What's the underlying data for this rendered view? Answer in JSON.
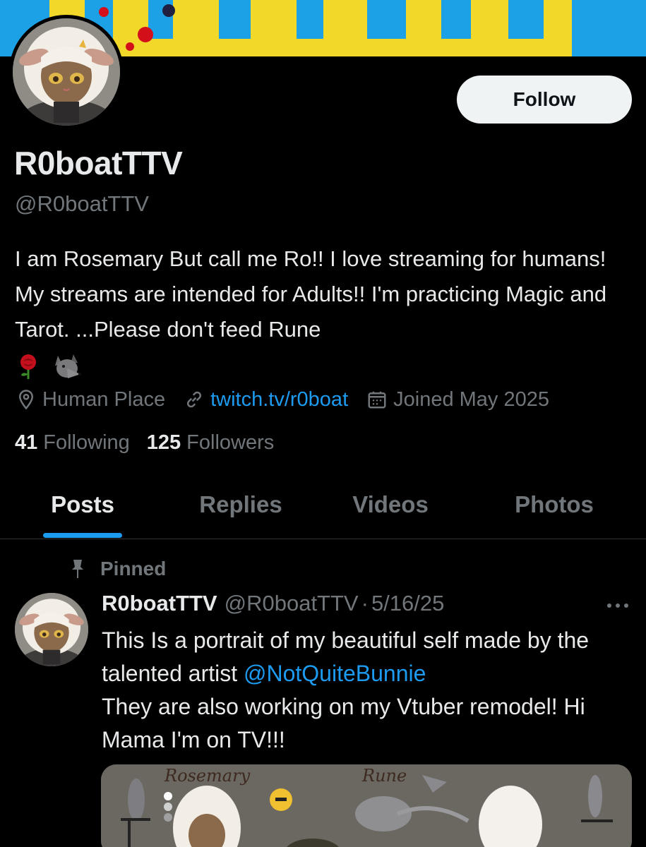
{
  "profile": {
    "display_name": "R0boatTTV",
    "handle": "@R0boatTTV",
    "follow_label": "Follow",
    "bio": "I am Rosemary But call me Ro!! I love streaming for humans! My streams are intended for Adults!! I'm practicing Magic and Tarot. ...Please don't feed Rune",
    "bio_emoji": [
      "rose-emoji",
      "wolf-emoji"
    ],
    "location": "Human Place",
    "website": "twitch.tv/r0boat",
    "joined": "Joined May 2025",
    "following_count": "41",
    "following_label": "Following",
    "followers_count": "125",
    "followers_label": "Followers"
  },
  "tabs": [
    {
      "label": "Posts",
      "active": true
    },
    {
      "label": "Replies",
      "active": false
    },
    {
      "label": "Videos",
      "active": false
    },
    {
      "label": "Photos",
      "active": false
    }
  ],
  "pinned_post": {
    "pinned_label": "Pinned",
    "author_name": "R0boatTTV",
    "author_handle": "@R0boatTTV",
    "separator": "·",
    "date": "5/16/25",
    "text_line1": "This Is a portrait of my beautiful self made by the talented artist ",
    "mention": "@NotQuiteBunnie",
    "text_line2": "They are also working on my Vtuber remodel! Hi Mama I'm on TV!!!",
    "media_labels": [
      "Rosemary",
      "Rune"
    ]
  },
  "colors": {
    "background": "#000000",
    "accent": "#1d9bf0",
    "primary_text": "#e7e9ea",
    "secondary_text": "#71767b",
    "follow_button_bg": "#eff3f4"
  }
}
